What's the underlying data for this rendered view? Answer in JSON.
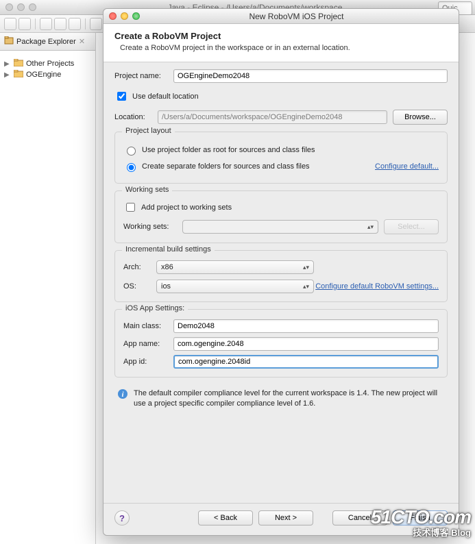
{
  "eclipse": {
    "title": "Java - Eclipse - /Users/a/Documents/workspace",
    "quick_placeholder": "Quic",
    "package_explorer": {
      "tab": "Package Explorer",
      "items": [
        "Other Projects",
        "OGEngine"
      ]
    }
  },
  "dialog": {
    "title": "New RoboVM iOS Project",
    "banner": {
      "heading": "Create a RoboVM Project",
      "sub": "Create a RoboVM project in the workspace or in an external location."
    },
    "project_name": {
      "label": "Project name:",
      "value": "OGEngineDemo2048"
    },
    "use_default": {
      "label": "Use default location",
      "checked": true
    },
    "location": {
      "label": "Location:",
      "value": "/Users/a/Documents/workspace/OGEngineDemo2048",
      "browse": "Browse..."
    },
    "layout": {
      "legend": "Project layout",
      "opt1": "Use project folder as root for sources and class files",
      "opt2": "Create separate folders for sources and class files",
      "selected": "opt2",
      "configure": "Configure default..."
    },
    "working_sets": {
      "legend": "Working sets",
      "add": "Add project to working sets",
      "label": "Working sets:",
      "select_btn": "Select..."
    },
    "build": {
      "legend": "Incremental build settings",
      "arch_label": "Arch:",
      "arch_value": "x86",
      "os_label": "OS:",
      "os_value": "ios",
      "configure": "Configure default RoboVM settings..."
    },
    "ios": {
      "legend": "iOS App Settings:",
      "main_class": {
        "label": "Main class:",
        "value": "Demo2048"
      },
      "app_name": {
        "label": "App name:",
        "value": "com.ogengine.2048"
      },
      "app_id": {
        "label": "App id:",
        "value": "com.ogengine.2048id"
      }
    },
    "info": "The default compiler compliance level for the current workspace is 1.4. The new project will use a project specific compiler compliance level of 1.6.",
    "footer": {
      "back": "< Back",
      "next": "Next >",
      "cancel": "Cancel",
      "finish": "Finish"
    }
  },
  "watermark": {
    "line1": "51CTO.com",
    "line2": "技术博客  Blog"
  }
}
